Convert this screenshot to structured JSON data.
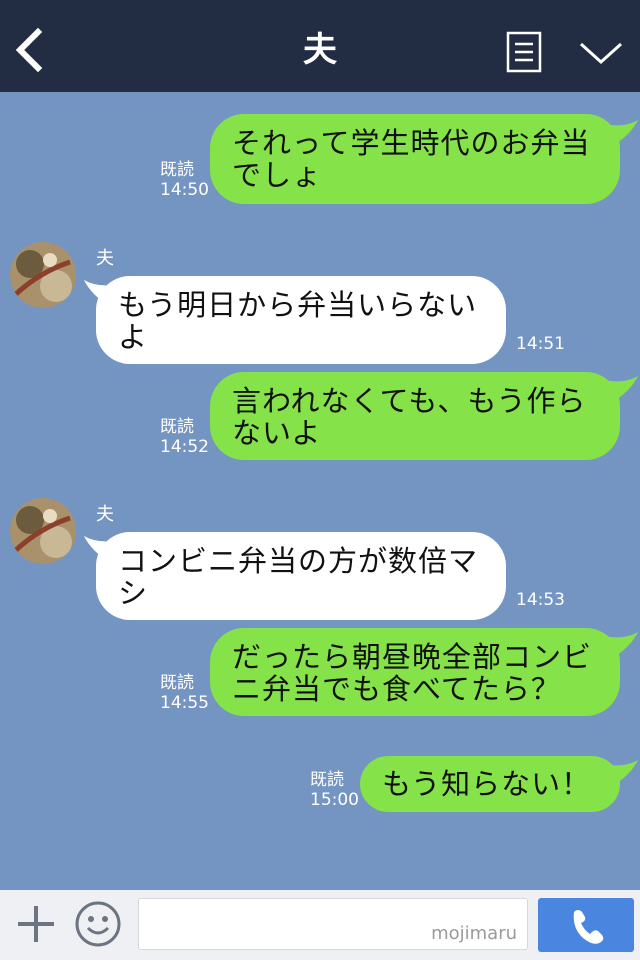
{
  "header": {
    "title": "夫",
    "back_icon": "chevron-left-icon",
    "menu_icon": "notes-icon",
    "collapse_icon": "chevron-down-icon"
  },
  "messages": [
    {
      "side": "out",
      "lines": [
        "それって学生時代のお弁当",
        "でしょ"
      ],
      "read": "既読",
      "time": "14:50"
    },
    {
      "side": "in",
      "sender": "夫",
      "lines": [
        "もう明日から弁当いらない",
        "よ"
      ],
      "time": "14:51"
    },
    {
      "side": "out",
      "lines": [
        "言われなくても、もう作ら",
        "ないよ"
      ],
      "read": "既読",
      "time": "14:52"
    },
    {
      "side": "in",
      "sender": "夫",
      "lines": [
        "コンビニ弁当の方が数倍マ",
        "シ"
      ],
      "time": "14:53"
    },
    {
      "side": "out",
      "lines": [
        "だったら朝昼晩全部コンビ",
        "ニ弁当でも食べてたら？"
      ],
      "read": "既読",
      "time": "14:55"
    },
    {
      "side": "out",
      "lines": [
        "もう知らない！"
      ],
      "read": "既読",
      "time": "15:00"
    }
  ],
  "input": {
    "placeholder": "",
    "watermark": "mojimaru",
    "plus_icon": "plus-icon",
    "emoji_icon": "smiley-icon",
    "call_icon": "phone-icon"
  },
  "colors": {
    "header_bg": "#222c43",
    "chat_bg": "#7495c2",
    "outgoing_bubble": "#85e249",
    "incoming_bubble": "#ffffff",
    "call_button": "#4a86e0"
  }
}
